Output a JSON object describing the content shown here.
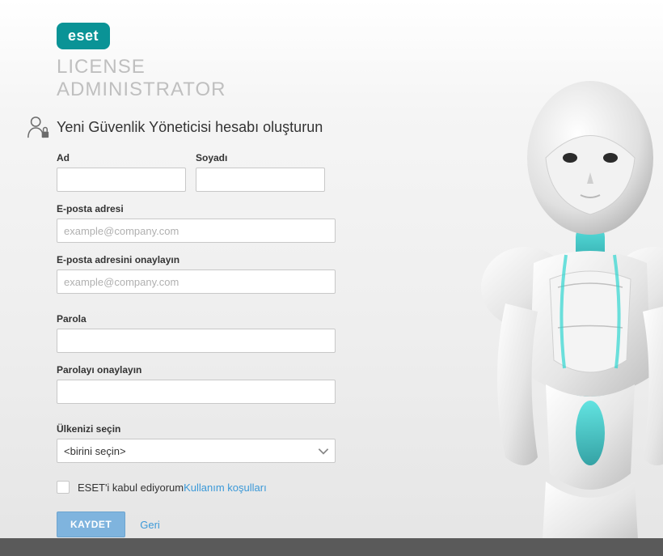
{
  "brand": {
    "logo_text": "eset",
    "product_line1": "LICENSE",
    "product_line2": "ADMINISTRATOR"
  },
  "page": {
    "heading": "Yeni Güvenlik Yöneticisi hesabı oluşturun"
  },
  "form": {
    "first_name": {
      "label": "Ad",
      "value": ""
    },
    "last_name": {
      "label": "Soyadı",
      "value": ""
    },
    "email": {
      "label": "E-posta adresi",
      "placeholder": "example@company.com",
      "value": ""
    },
    "email_confirm": {
      "label": "E-posta adresini onaylayın",
      "placeholder": "example@company.com",
      "value": ""
    },
    "password": {
      "label": "Parola",
      "value": ""
    },
    "password_confirm": {
      "label": "Parolayı onaylayın",
      "value": ""
    },
    "country": {
      "label": "Ülkenizi seçin",
      "selected": "<birini seçin>"
    },
    "terms": {
      "prefix": "ESET'i kabul ediyorum ",
      "link": "Kullanım koşulları"
    },
    "actions": {
      "save": "KAYDET",
      "back": "Geri"
    }
  }
}
